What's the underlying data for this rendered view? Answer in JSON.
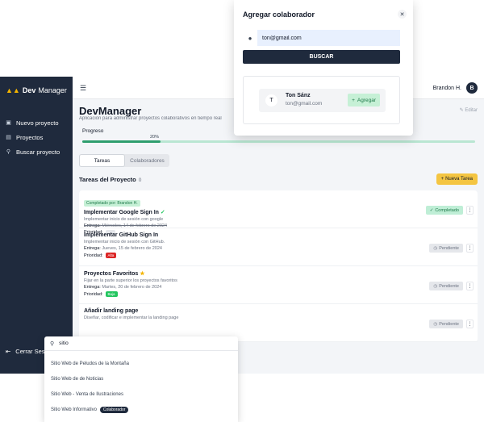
{
  "brand": {
    "dev": "Dev",
    "manager": "Manager"
  },
  "sidebar": {
    "items": [
      {
        "label": "Nuevo proyecto",
        "icon": "plus-square-icon"
      },
      {
        "label": "Proyectos",
        "icon": "list-icon"
      },
      {
        "label": "Buscar proyecto",
        "icon": "search-icon"
      }
    ],
    "logout": "Cerrar Sesión"
  },
  "topbar": {
    "user_name": "Brandon H.",
    "avatar_initial": "B"
  },
  "project": {
    "title": "DevManager",
    "subtitle": "Aplicación para administrar proyectos colaborativos en tiempo real",
    "edit_label": "Editar"
  },
  "progress": {
    "label": "Progreso",
    "percent_label": "20%",
    "value": 0.2
  },
  "tabs": [
    {
      "label": "Tareas"
    },
    {
      "label": "Colaboradores"
    }
  ],
  "tasks_section": {
    "title": "Tareas del Proyecto",
    "count": "0",
    "new_task_label": "Nueva Tarea"
  },
  "tasks": [
    {
      "assigned": "Completado por: Brandon H.",
      "title": "Implementar Google Sign In",
      "description": "Implementar inicio de sesión con google",
      "due_label": "Entrega:",
      "due": "Miércoles, 14 de febrero de 2024",
      "priority_label": "Prioridad:",
      "priority": "",
      "status": "Completado"
    },
    {
      "title": "Implementar GitHub Sign In",
      "description": "Implementar inicio de sesión con GitHub.",
      "due_label": "Entrega:",
      "due": "Jueves, 15 de febrero de 2024",
      "priority_label": "Prioridad:",
      "priority": "Alta",
      "status": "Pendiente"
    },
    {
      "title": "Proyectos Favoritos",
      "description": "Fijar en la parte superior los proyectos favoritos",
      "due_label": "Entrega:",
      "due": "Martes, 20 de febrero de 2024",
      "priority_label": "Prioridad:",
      "priority": "Baja",
      "status": "Pendiente"
    },
    {
      "title": "Añadir landing page",
      "description": "Diseñar, codificar e implementar la landing page",
      "status": "Pendiente"
    }
  ],
  "modal": {
    "title": "Agregar colaborador",
    "email_value": "ton@gmail.com",
    "search_label": "BUSCAR",
    "result": {
      "initial": "T",
      "name": "Ton Sánz",
      "email": "ton@gmail.com",
      "add_label": "Agregar"
    }
  },
  "search_pop": {
    "query": "sitio",
    "results": [
      {
        "label": "Sitio Web de Peludos de la Montaña"
      },
      {
        "label": "Sitio Web de de Noticias"
      },
      {
        "label": "Sitio Web - Venta de Ilustraciones"
      },
      {
        "label": "Sitio Web Informativo",
        "badge": "Colaborador"
      }
    ]
  },
  "colors": {
    "sidebar": "#1f2a3d",
    "accent_yellow": "#f4c542",
    "progress": "#2f9e6e",
    "success_bg": "#c6f0d6",
    "danger": "#dc2626"
  }
}
